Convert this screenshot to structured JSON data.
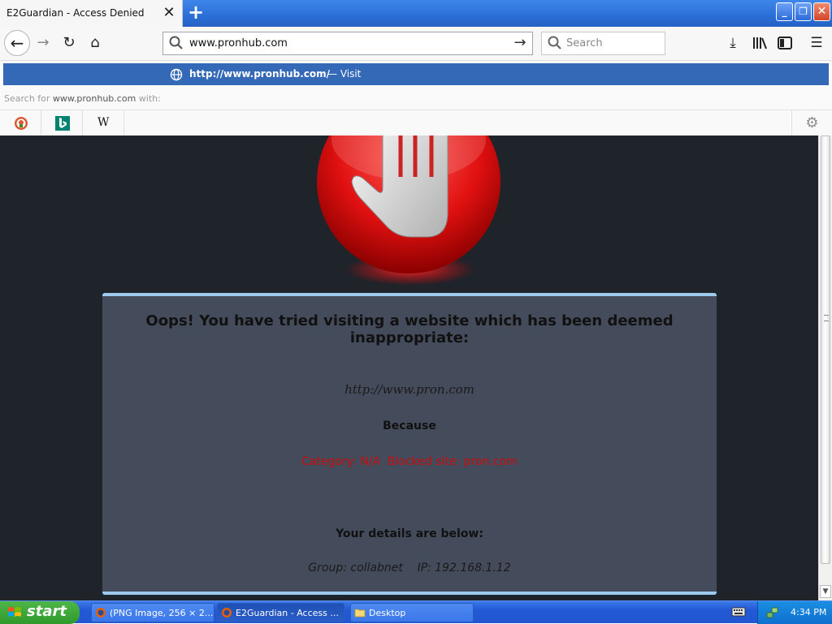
{
  "browser": {
    "tab_title": "E2Guardian - Access Denied",
    "url": "www.pronhub.com",
    "search_placeholder": "Search"
  },
  "url_popup": {
    "suggestion_url": "http://www.pronhub.com/",
    "suggestion_action": "— Visit",
    "search_for_prefix": "Search for",
    "search_for_term": "www.pronhub.com",
    "search_for_suffix": "with:",
    "engines": [
      "duckduckgo-icon",
      "bing-icon",
      "wikipedia-icon"
    ],
    "wiki_glyph": "W"
  },
  "page": {
    "headline": "Oops! You have tried visiting a website which has been deemed inappropriate:",
    "blocked_url": "http://www.pron.com",
    "because": "Because",
    "reason": "Category: N/A  Blocked site: pron.com",
    "details_heading": "Your details are below:",
    "details_line": "Group: collabnet    IP: 192.168.1.12",
    "colors": {
      "background": "#1f232a",
      "panel": "#444b5a",
      "panel_border": "#9ccbef",
      "reason": "#c80d0d"
    }
  },
  "taskbar": {
    "start_label": "start",
    "tasks": [
      {
        "label": "(PNG Image, 256 × 2..."
      },
      {
        "label": "E2Guardian - Access ..."
      },
      {
        "label": "Desktop"
      }
    ],
    "clock": "4:34 PM"
  }
}
